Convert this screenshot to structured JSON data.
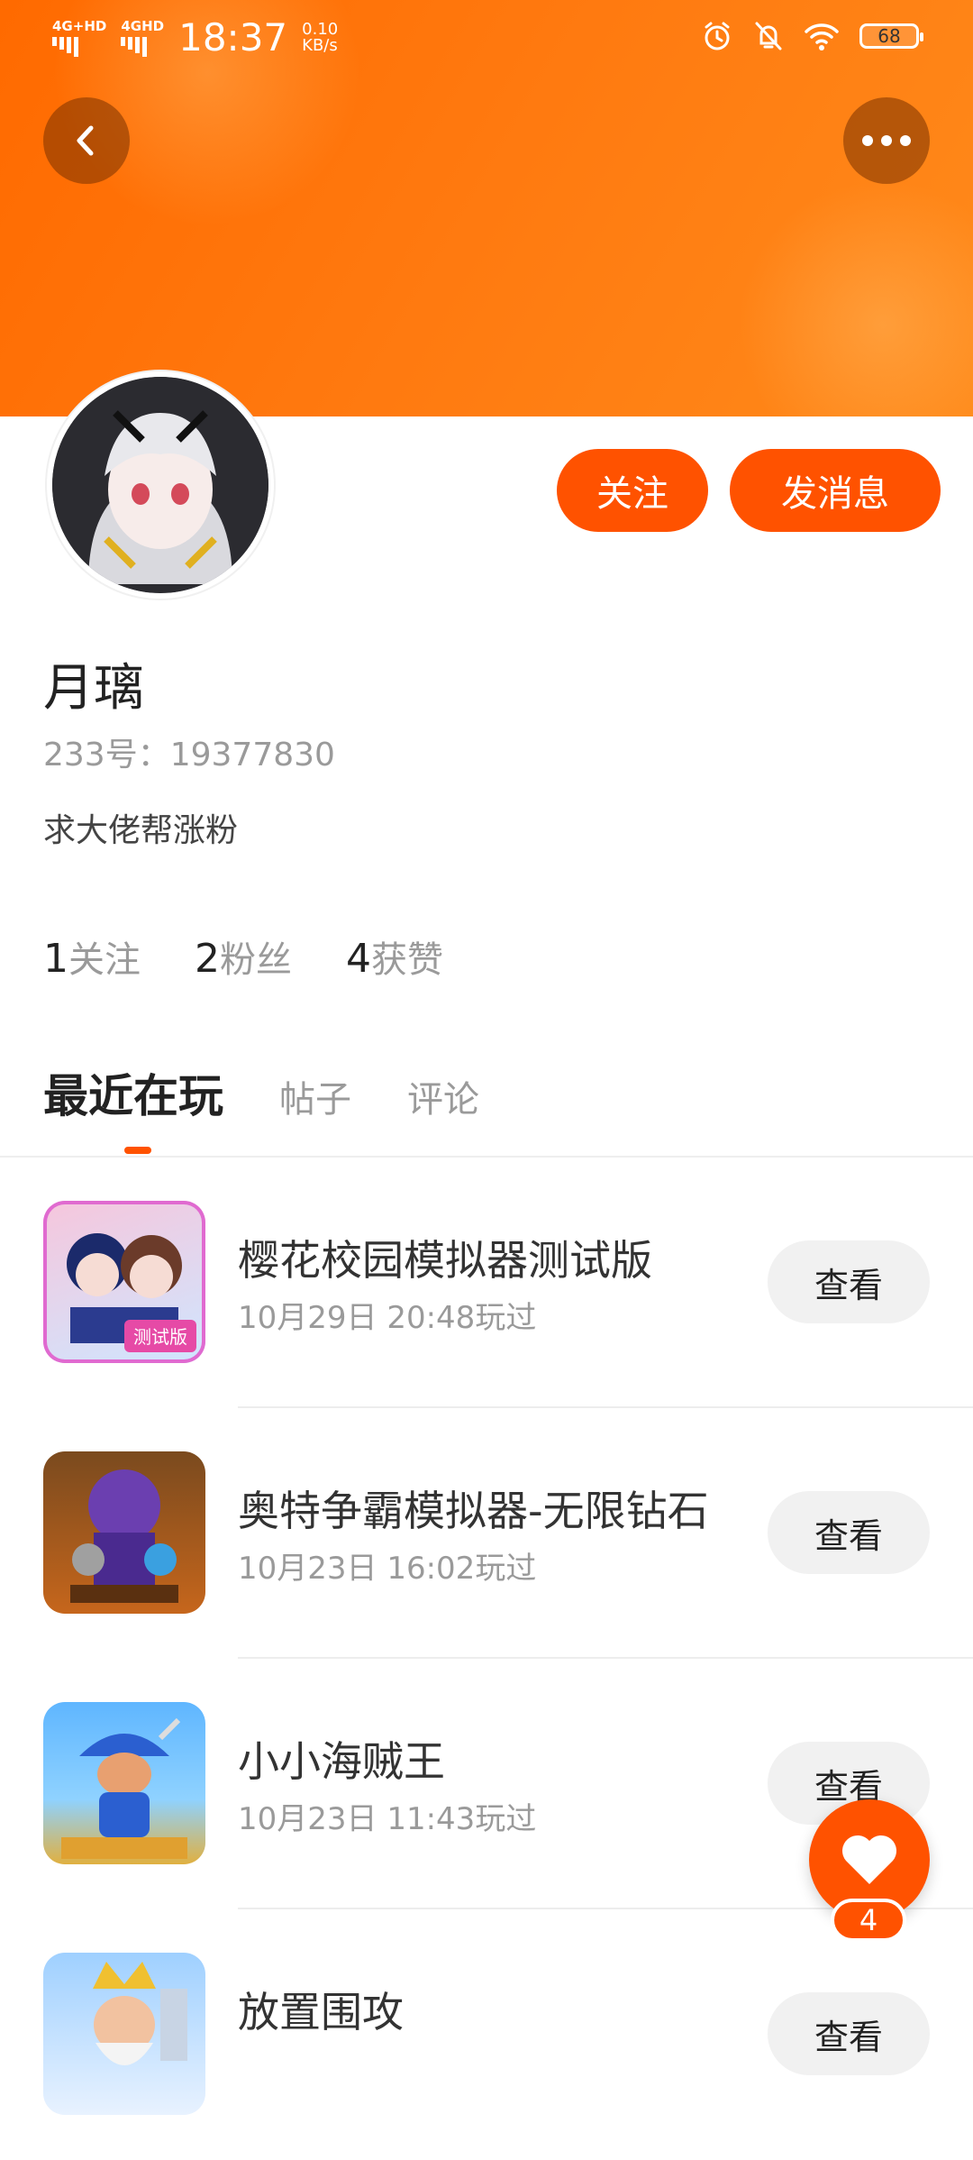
{
  "status_bar": {
    "net1": "4G+HD",
    "net2": "4GHD",
    "time": "18:37",
    "speed_value": "0.10",
    "speed_unit": "KB/s",
    "battery": "68"
  },
  "header": {
    "back_icon": "chevron-left-icon",
    "more_icon": "more-dots-icon"
  },
  "profile": {
    "name": "月璃",
    "uid": "233号：19377830",
    "bio": "求大佬帮涨粉",
    "follow_label": "关注",
    "message_label": "发消息",
    "stats": [
      {
        "num": "1",
        "label": "关注"
      },
      {
        "num": "2",
        "label": "粉丝"
      },
      {
        "num": "4",
        "label": "获赞"
      }
    ]
  },
  "tabs": [
    "最近在玩",
    "帖子",
    "评论"
  ],
  "games": [
    {
      "title": "樱花校园模拟器测试版",
      "time": "10月29日 20:48玩过",
      "button": "查看",
      "badge": "测试版"
    },
    {
      "title": "奥特争霸模拟器-无限钻石",
      "time": "10月23日 16:02玩过",
      "button": "查看"
    },
    {
      "title": "小小海贼王",
      "time": "10月23日 11:43玩过",
      "button": "查看"
    },
    {
      "title": "放置围攻",
      "time": "",
      "button": "查看"
    }
  ],
  "like_fab": {
    "count": "4"
  },
  "colors": {
    "accent": "#ff5200",
    "hero_start": "#ff6a00",
    "hero_end": "#ff8a1a"
  }
}
